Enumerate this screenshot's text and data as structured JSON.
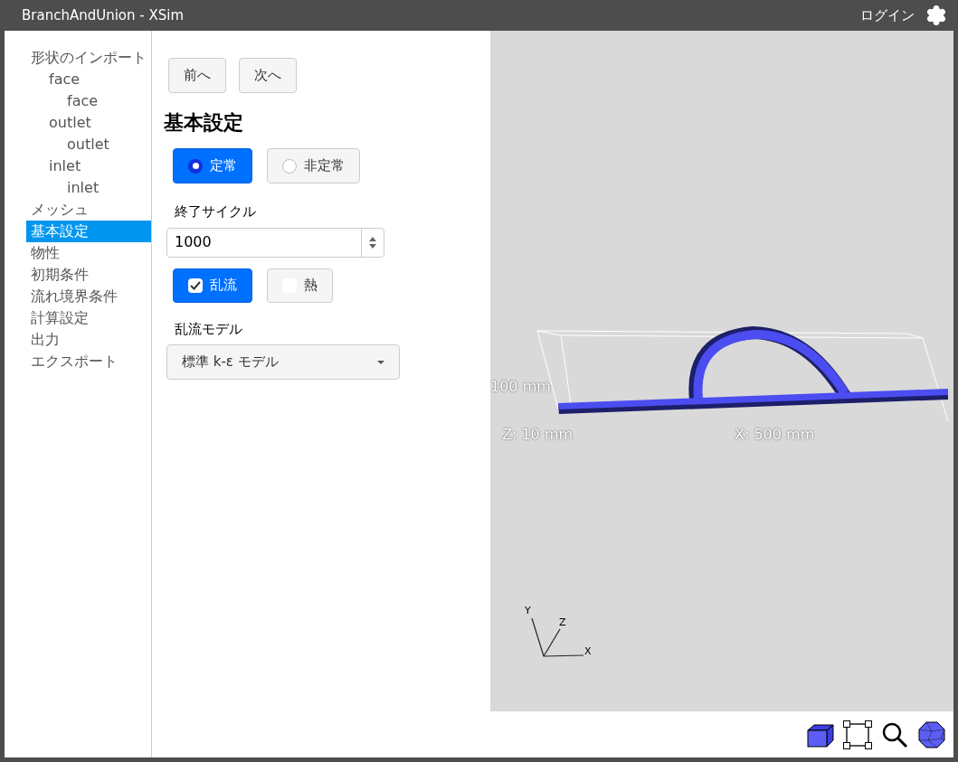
{
  "window": {
    "title": "BranchAndUnion - XSim",
    "login": "ログイン"
  },
  "sidebar": {
    "items": [
      {
        "label": "形状のインポート",
        "selected": false,
        "children": [
          {
            "label": "face",
            "selected": false,
            "children": [
              {
                "label": "face",
                "selected": false
              }
            ]
          },
          {
            "label": "outlet",
            "selected": false,
            "children": [
              {
                "label": "outlet",
                "selected": false
              }
            ]
          },
          {
            "label": "inlet",
            "selected": false,
            "children": [
              {
                "label": "inlet",
                "selected": false
              }
            ]
          }
        ]
      },
      {
        "label": "メッシュ",
        "selected": false
      },
      {
        "label": "基本設定",
        "selected": true
      },
      {
        "label": "物性",
        "selected": false
      },
      {
        "label": "初期条件",
        "selected": false
      },
      {
        "label": "流れ境界条件",
        "selected": false
      },
      {
        "label": "計算設定",
        "selected": false
      },
      {
        "label": "出力",
        "selected": false
      },
      {
        "label": "エクスポート",
        "selected": false
      }
    ]
  },
  "nav_buttons": [
    "前へ",
    "次へ"
  ],
  "heading": "基本設定",
  "mode": [
    {
      "label": "定常",
      "selected": true
    },
    {
      "label": "非定常",
      "selected": false
    }
  ],
  "end_cycle": {
    "label": "終了サイクル",
    "value": "1000"
  },
  "options": [
    {
      "label": "乱流",
      "checked": true
    },
    {
      "label": "熱",
      "checked": false
    }
  ],
  "turbulence_model": {
    "label": "乱流モデル",
    "value": "標準 k-ε モデル"
  },
  "viewport": {
    "height_label": "100 mm",
    "z_label": "Z: 10 mm",
    "x_label": "X: 500 mm",
    "axes": {
      "y": "Y",
      "z": "Z",
      "x": "X"
    }
  }
}
